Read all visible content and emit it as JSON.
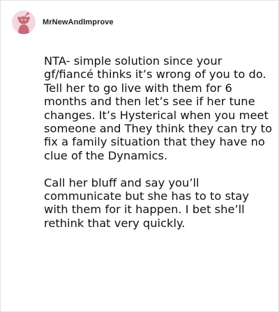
{
  "comment": {
    "username": "MrNewAndImprove",
    "avatar_icon": "reddit-snoo-avatar-icon",
    "paragraphs": [
      "NTA- simple solution since your gf/fiancé thinks it’s wrong of you to do. Tell her to go live with them for 6 months and then let’s see if her tune changes. It’s Hysterical when you meet someone and They think they can try to fix a family situation that they have no clue of the Dynamics.",
      "Call her bluff and say you’ll communicate but she has to to stay with them for it happen. I bet she’ll rethink that very quickly."
    ]
  },
  "colors": {
    "avatar_bg": "#f3d9de",
    "avatar_fg": "#c96a7c",
    "border": "#e3e3e3"
  }
}
